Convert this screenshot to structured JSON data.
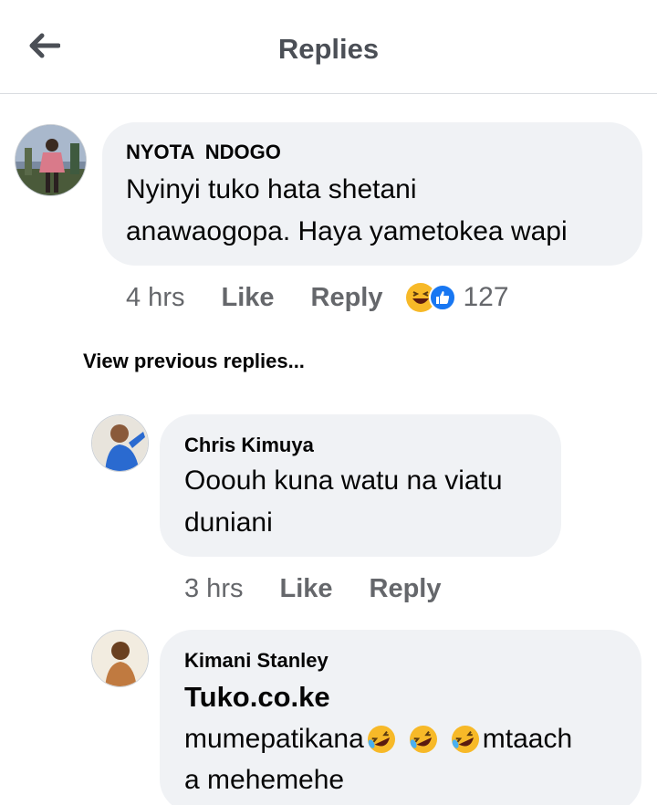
{
  "header": {
    "title": "Replies"
  },
  "comment": {
    "author": "NYOTA  NDOGO",
    "text_line1": "Nyinyi tuko hata shetani",
    "text_line2": "anawaogopa. Haya yametokea wapi",
    "time": "4 hrs",
    "like_label": "Like",
    "reply_label": "Reply",
    "reactions": [
      "haha-icon",
      "like-icon"
    ],
    "reaction_count": "127"
  },
  "view_previous": "View previous replies...",
  "replies": [
    {
      "author": "Chris Kimuya",
      "text_line1": "Ooouh kuna watu na viatu",
      "text_line2": "duniani",
      "time": "3 hrs",
      "like_label": "Like",
      "reply_label": "Reply"
    },
    {
      "author": "Kimani Stanley",
      "tag": "Tuko.co.ke",
      "text_line1_a": "mumepatikana",
      "text_line1_b": "mtaach",
      "text_line2": "a mehemehe"
    }
  ],
  "colors": {
    "bubble": "#f0f2f5",
    "meta": "#65676b",
    "like_blue": "#1877f2",
    "haha_yellow": "#f7b928"
  }
}
